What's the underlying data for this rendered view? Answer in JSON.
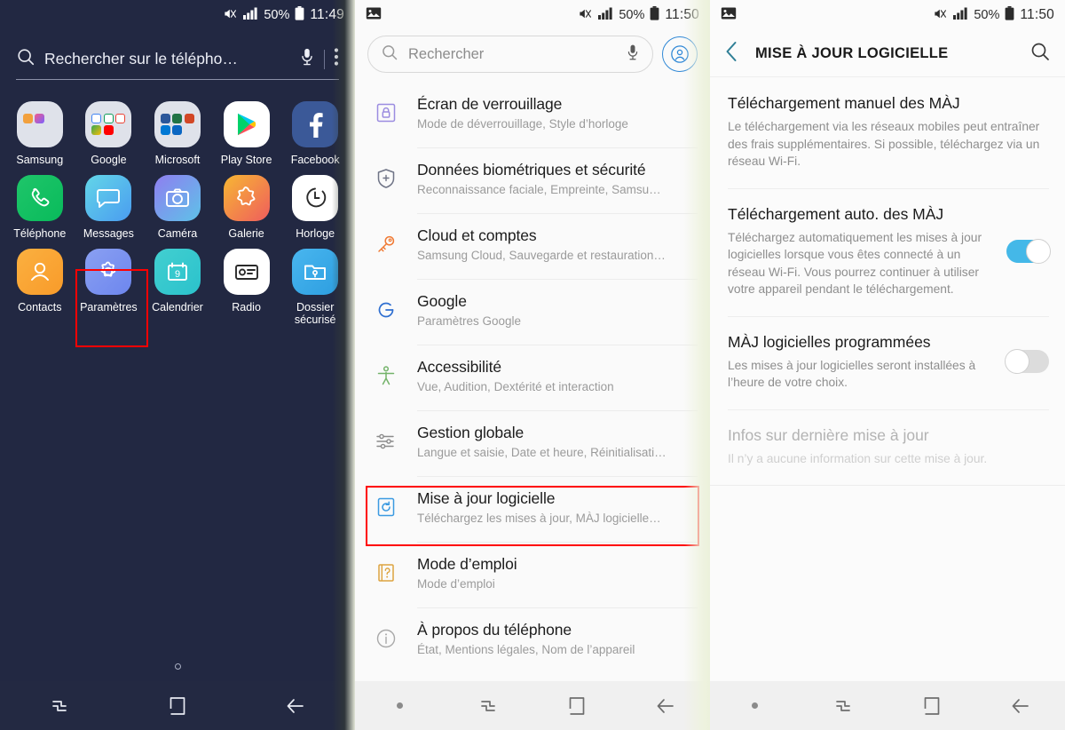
{
  "panel_home": {
    "status": {
      "time": "11:49",
      "battery_pct": "50%",
      "icons": [
        "mute-icon",
        "signal-icon",
        "battery-icon"
      ]
    },
    "search": {
      "placeholder": "Rechercher sur le télépho…",
      "mic_icon": "microphone-icon",
      "more_icon": "overflow-menu-icon",
      "search_icon": "search-icon"
    },
    "apps": [
      [
        {
          "label": "Samsung",
          "type": "folder",
          "tiles": [
            "#f2a03d",
            "#ef5aa0",
            "#ffffff",
            "#ffffff",
            "#ffffff",
            "#ffffff"
          ]
        },
        {
          "label": "Google",
          "type": "folder",
          "tiles": [
            "#4285f4",
            "#ea4335",
            "#ea4335",
            "#34a853",
            "#ff0000",
            "#ffffff"
          ]
        },
        {
          "label": "Microsoft",
          "type": "folder",
          "tiles": [
            "#2b579a",
            "#217346",
            "#d24726",
            "#0078d4",
            "#0a66c2",
            "#ffffff"
          ]
        },
        {
          "label": "Play Store",
          "type": "playstore"
        },
        {
          "label": "Facebook",
          "type": "facebook"
        }
      ],
      [
        {
          "label": "Téléphone",
          "type": "phone"
        },
        {
          "label": "Messages",
          "type": "messages"
        },
        {
          "label": "Caméra",
          "type": "camera"
        },
        {
          "label": "Galerie",
          "type": "gallery"
        },
        {
          "label": "Horloge",
          "type": "clock"
        }
      ],
      [
        {
          "label": "Contacts",
          "type": "contacts"
        },
        {
          "label": "Paramètres",
          "type": "settings",
          "highlighted": true
        },
        {
          "label": "Calendrier",
          "type": "calendar",
          "day": "9"
        },
        {
          "label": "Radio",
          "type": "radio"
        },
        {
          "label": "Dossier sécurisé",
          "type": "securefolder"
        }
      ]
    ],
    "nav": [
      "recents-icon",
      "home-icon",
      "back-icon"
    ]
  },
  "panel_settings": {
    "status": {
      "time": "11:50",
      "battery_pct": "50%",
      "photo_icon": "photo-icon"
    },
    "search": {
      "placeholder": "Rechercher",
      "mic_icon": "microphone-icon",
      "avatar_icon": "account-avatar-icon"
    },
    "items": [
      {
        "icon": "lock-icon",
        "title": "Écran de verrouillage",
        "subtitle": "Mode de déverrouillage, Style d’horloge"
      },
      {
        "icon": "shield-plus-icon",
        "title": "Données biométriques et sécurité",
        "subtitle": "Reconnaissance faciale, Empreinte, Samsu…"
      },
      {
        "icon": "key-icon",
        "title": "Cloud et comptes",
        "subtitle": "Samsung Cloud, Sauvegarde et restauration…"
      },
      {
        "icon": "google-g-icon",
        "title": "Google",
        "subtitle": "Paramètres Google"
      },
      {
        "icon": "accessibility-icon",
        "title": "Accessibilité",
        "subtitle": "Vue, Audition, Dextérité et interaction"
      },
      {
        "icon": "sliders-icon",
        "title": "Gestion globale",
        "subtitle": "Langue et saisie, Date et heure, Réinitialisati…"
      },
      {
        "icon": "software-update-icon",
        "title": "Mise à jour logicielle",
        "subtitle": "Téléchargez les mises à jour, MÀJ logicielle…",
        "highlighted": true
      },
      {
        "icon": "user-manual-icon",
        "title": "Mode d’emploi",
        "subtitle": "Mode d’emploi"
      },
      {
        "icon": "info-icon",
        "title": "À propos du téléphone",
        "subtitle": "État, Mentions légales, Nom de l’appareil"
      }
    ],
    "nav": [
      "page-dot",
      "recents-icon",
      "home-icon",
      "back-icon"
    ]
  },
  "panel_update": {
    "status": {
      "time": "11:50",
      "battery_pct": "50%",
      "photo_icon": "photo-icon"
    },
    "header": {
      "back_icon": "back-chevron-icon",
      "title": "MISE À JOUR LOGICIELLE",
      "search_icon": "search-icon"
    },
    "rows": [
      {
        "title": "Téléchargement manuel des MÀJ",
        "desc": "Le téléchargement via les réseaux mobiles peut entraîner des frais supplémentaires. Si possible, téléchargez via un réseau Wi-Fi.",
        "toggle": null,
        "disabled": false
      },
      {
        "title": "Téléchargement auto. des MÀJ",
        "desc": "Téléchargez automatiquement les mises à jour logicielles lorsque vous êtes connecté à un réseau Wi-Fi. Vous pourrez continuer à utiliser votre appareil pendant le téléchargement.",
        "toggle": "on",
        "disabled": false
      },
      {
        "title": "MÀJ logicielles programmées",
        "desc": "Les mises à jour logicielles seront installées à l’heure de votre choix.",
        "toggle": "off",
        "disabled": false
      },
      {
        "title": "Infos sur dernière mise à jour",
        "desc": "Il n’y a aucune information sur cette mise à jour.",
        "toggle": null,
        "disabled": true
      }
    ],
    "nav": [
      "page-dot",
      "recents-icon",
      "home-icon",
      "back-icon"
    ]
  },
  "colors": {
    "home_bg": "#222842",
    "highlight": "#ff0000",
    "toggle_on": "#44b8e8",
    "toggle_off": "#dcdcdc",
    "accent_blue": "#2f88d6"
  }
}
